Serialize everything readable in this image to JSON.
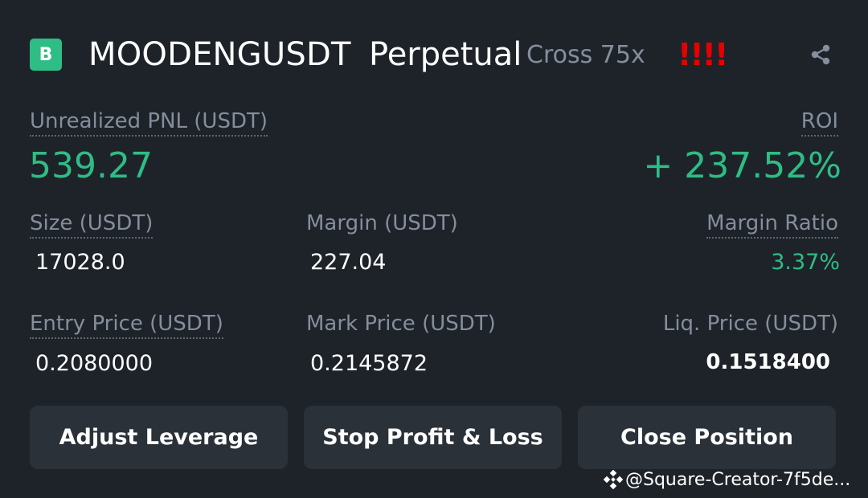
{
  "header": {
    "badge_letter": "B",
    "symbol": "MOODENGUSDT",
    "contract_type": "Perpetual",
    "margin_mode": "Cross 75x",
    "warning": "!!!!",
    "share_icon": "share-icon"
  },
  "pnl": {
    "label": "Unrealized PNL (USDT)",
    "value": "539.27",
    "roi_label": "ROI",
    "roi_value": "+ 237.52%"
  },
  "stats_row1": {
    "size_label": "Size (USDT)",
    "size_value": "17028.0",
    "margin_label": "Margin (USDT)",
    "margin_value": "227.04",
    "margin_ratio_label": "Margin Ratio",
    "margin_ratio_value": "3.37%"
  },
  "stats_row2": {
    "entry_label": "Entry Price (USDT)",
    "entry_value": "0.2080000",
    "mark_label": "Mark Price (USDT)",
    "mark_value": "0.2145872",
    "liq_label": "Liq. Price (USDT)",
    "liq_value": "0.1518400"
  },
  "actions": {
    "adjust_leverage": "Adjust Leverage",
    "stop_profit_loss": "Stop Profit & Loss",
    "close_position": "Close Position"
  },
  "watermark": {
    "text": "@Square-Creator-7f5de..."
  },
  "colors": {
    "background": "#1e2329",
    "profit_green": "#2ebd85",
    "button_bg": "#2b3139",
    "muted_text": "#848e9c",
    "warning_red": "#e60000"
  }
}
